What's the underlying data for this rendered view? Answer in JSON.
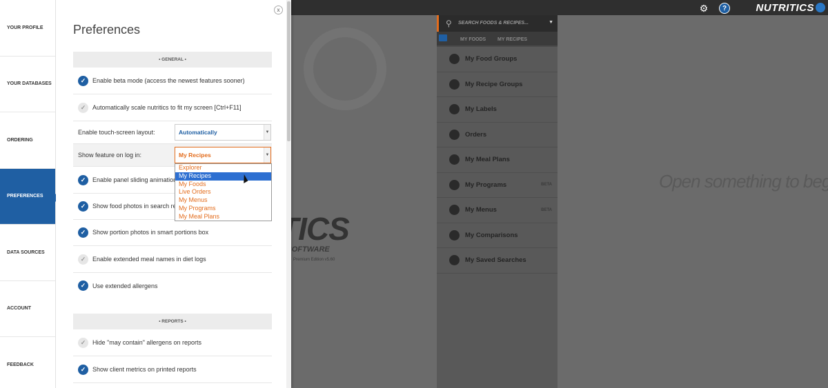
{
  "app": {
    "brand": "NUTRITICS",
    "settings_icon": "gear-icon",
    "help_icon": "help-icon",
    "help_label": "?",
    "open_prompt": "Open something to begin",
    "watermark": "TICS",
    "watermark_sub": "S SOFTWARE",
    "watermark_edition": "Premium Edition v5.60"
  },
  "sidebar": {
    "items": [
      {
        "label": "YOUR PROFILE",
        "active": false
      },
      {
        "label": "YOUR DATABASES",
        "active": false
      },
      {
        "label": "ORDERING",
        "active": false
      },
      {
        "label": "PREFERENCES",
        "active": true
      },
      {
        "label": "DATA SOURCES",
        "active": false
      },
      {
        "label": "ACCOUNT",
        "active": false
      },
      {
        "label": "FEEDBACK",
        "active": false
      }
    ]
  },
  "preferences": {
    "title": "Preferences",
    "close_label": "x",
    "sections": {
      "general": "• GENERAL •",
      "reports": "• REPORTS •"
    },
    "general_rows": [
      {
        "label": "Enable beta mode (access the newest features sooner)",
        "checked": true
      },
      {
        "label": "Automatically scale nutritics to fit my screen [Ctrl+F11]",
        "checked": false
      }
    ],
    "touch_screen": {
      "label": "Enable touch-screen layout:",
      "value": "Automatically"
    },
    "show_feature": {
      "label": "Show feature on log in:",
      "value": "My Recipes"
    },
    "general_rows_2": [
      {
        "label": "Enable panel sliding animations",
        "checked": true
      },
      {
        "label": "Show food photos in search results",
        "checked": true
      },
      {
        "label": "Show portion photos in smart portions box",
        "checked": true
      },
      {
        "label": "Enable extended meal names in diet logs",
        "checked": false
      },
      {
        "label": "Use extended allergens",
        "checked": true
      }
    ],
    "report_rows": [
      {
        "label": "Hide \"may contain\" allergens on reports",
        "checked": false
      },
      {
        "label": "Show client metrics on printed reports",
        "checked": true
      }
    ],
    "dropdown_options": [
      "Explorer",
      "My Recipes",
      "My Foods",
      "Live Orders",
      "My Menus",
      "My Programs",
      "My Meal Plans"
    ],
    "dropdown_selected": "My Recipes"
  },
  "library": {
    "search_placeholder": "SEARCH FOODS & RECIPES...",
    "tabs": [
      "MY FOODS",
      "MY RECIPES"
    ],
    "items": [
      {
        "label": "My Food Groups",
        "icon": "apple-icon",
        "beta": ""
      },
      {
        "label": "My Recipe Groups",
        "icon": "chef-hat-icon",
        "beta": ""
      },
      {
        "label": "My Labels",
        "icon": "tag-icon",
        "beta": ""
      },
      {
        "label": "Orders",
        "icon": "orders-icon",
        "beta": ""
      },
      {
        "label": "My Meal Plans",
        "icon": "meal-plan-icon",
        "beta": ""
      },
      {
        "label": "My Programs",
        "icon": "program-icon",
        "beta": "BETA"
      },
      {
        "label": "My Menus",
        "icon": "cutlery-icon",
        "beta": "BETA"
      },
      {
        "label": "My Comparisons",
        "icon": "scales-icon",
        "beta": ""
      },
      {
        "label": "My Saved Searches",
        "icon": "saved-search-icon",
        "beta": ""
      }
    ]
  }
}
